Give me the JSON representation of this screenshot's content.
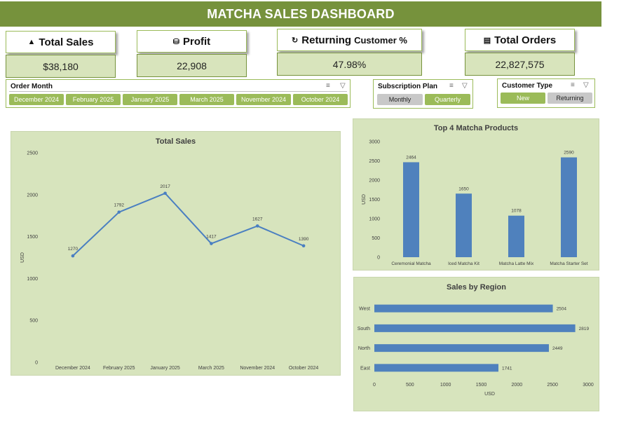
{
  "dashboard": {
    "title": "MATCHA SALES DASHBOARD"
  },
  "kpis": {
    "total_sales": {
      "label": "Total Sales",
      "value": "$38,180",
      "icon": "money-stack-icon"
    },
    "profit": {
      "label": "Profit",
      "value": "22,908",
      "icon": "coins-icon"
    },
    "returning": {
      "label": "Returning",
      "label_small": "Customer %",
      "value": "47.98%",
      "icon": "refresh-icon"
    },
    "orders": {
      "label": "Total Orders",
      "value": "22,827,575",
      "icon": "receipt-icon"
    }
  },
  "slicers": {
    "order_month": {
      "title": "Order Month",
      "items": [
        "December 2024",
        "February 2025",
        "January 2025",
        "March 2025",
        "November 2024",
        "October 2024"
      ]
    },
    "subscription_plan": {
      "title": "Subscription Plan",
      "items": [
        "Monthly",
        "Quarterly"
      ]
    },
    "customer_type": {
      "title": "Customer Type",
      "items": [
        "New",
        "Returning"
      ]
    }
  },
  "chart_data": [
    {
      "type": "line",
      "title": "Total Sales",
      "ylabel": "USD",
      "categories": [
        "December 2024",
        "February 2025",
        "January 2025",
        "March 2025",
        "November 2024",
        "October 2024"
      ],
      "values": [
        1270,
        1792,
        2017,
        1417,
        1627,
        1390
      ],
      "ylim": [
        0,
        2500
      ],
      "yticks": [
        0,
        500,
        1000,
        1500,
        2000,
        2500
      ],
      "line_color": "#4a7fc1",
      "data_labels": true
    },
    {
      "type": "bar",
      "title": "Top 4 Matcha Products",
      "ylabel": "USD",
      "categories": [
        "Ceremonial Matcha",
        "Iced Matcha Kit",
        "Matcha Latte Mix",
        "Matcha Starter Set"
      ],
      "values": [
        2464,
        1650,
        1078,
        2590
      ],
      "ylim": [
        0,
        3000
      ],
      "yticks": [
        0,
        500,
        1000,
        1500,
        2000,
        2500,
        3000
      ],
      "bar_color": "#4f81bd",
      "data_labels": true
    },
    {
      "type": "bar",
      "orientation": "horizontal",
      "title": "Sales by Region",
      "xlabel": "USD",
      "categories": [
        "West",
        "South",
        "North",
        "East"
      ],
      "values": [
        2504,
        2819,
        2449,
        1741
      ],
      "xlim": [
        0,
        3000
      ],
      "xticks": [
        0,
        500,
        1000,
        1500,
        2000,
        2500,
        3000
      ],
      "bar_color": "#4f81bd",
      "data_labels": true
    }
  ]
}
